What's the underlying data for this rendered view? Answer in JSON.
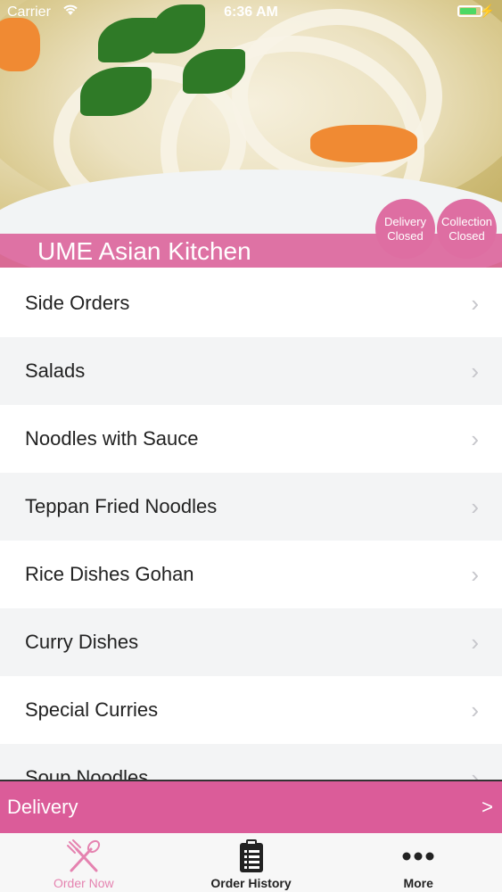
{
  "status_bar": {
    "carrier": "Carrier",
    "time": "6:36 AM"
  },
  "header": {
    "restaurant_name": "UME Asian Kitchen",
    "delivery_status": {
      "line1": "Delivery",
      "line2": "Closed"
    },
    "collection_status": {
      "line1": "Collection",
      "line2": "Closed"
    }
  },
  "menu": {
    "items": [
      {
        "label": "Side Orders"
      },
      {
        "label": "Salads"
      },
      {
        "label": "Noodles with Sauce"
      },
      {
        "label": "Teppan Fried Noodles"
      },
      {
        "label": "Rice Dishes Gohan"
      },
      {
        "label": "Curry Dishes"
      },
      {
        "label": "Special Curries"
      },
      {
        "label": "Soup Noodles"
      }
    ]
  },
  "order_type_bar": {
    "label": "Delivery",
    "arrow": ">"
  },
  "tab_bar": {
    "tabs": [
      {
        "label": "Order Now",
        "icon": "fork-knife-icon",
        "active": true
      },
      {
        "label": "Order History",
        "icon": "clipboard-icon",
        "active": false
      },
      {
        "label": "More",
        "icon": "more-dots-icon",
        "active": false
      }
    ]
  },
  "colors": {
    "accent": "#db5c99",
    "active_tab": "#e583b0",
    "row_alt": "#f3f4f5",
    "battery": "#4cd964"
  }
}
